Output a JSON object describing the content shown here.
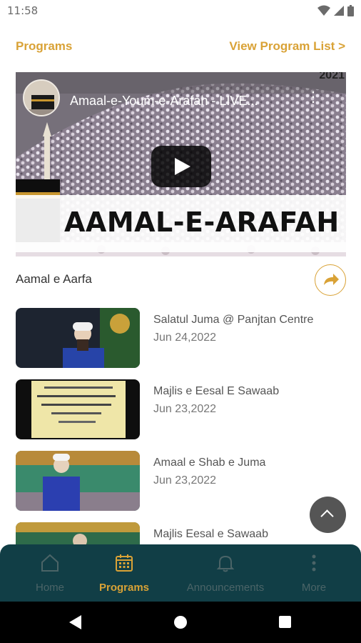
{
  "status_bar": {
    "time": "11:58"
  },
  "header": {
    "title": "Programs",
    "link": "View Program List >"
  },
  "featured": {
    "video_title": "Amaal-e-Youm-e-Arafah - LIVE...",
    "banner_text": "AAMAL-E-ARAFAH",
    "year_text": "2021",
    "caption": "Aamal e Aarfa"
  },
  "programs": [
    {
      "title": "Salatul Juma @ Panjtan Centre",
      "date": "Jun 24,2022"
    },
    {
      "title": "Majlis e Eesal E Sawaab",
      "date": "Jun 23,2022"
    },
    {
      "title": "Amaal e Shab e Juma",
      "date": "Jun 23,2022"
    },
    {
      "title": "Majlis Eesal e Sawaab",
      "date": ""
    }
  ],
  "nav": {
    "items": [
      {
        "label": "Home",
        "icon": "home-icon"
      },
      {
        "label": "Programs",
        "icon": "calendar-icon"
      },
      {
        "label": "Announcements",
        "icon": "bell-icon"
      },
      {
        "label": "More",
        "icon": "more-vertical-icon"
      }
    ],
    "active": "Programs"
  },
  "colors": {
    "accent": "#d9a236",
    "nav_bg": "#113e46"
  }
}
